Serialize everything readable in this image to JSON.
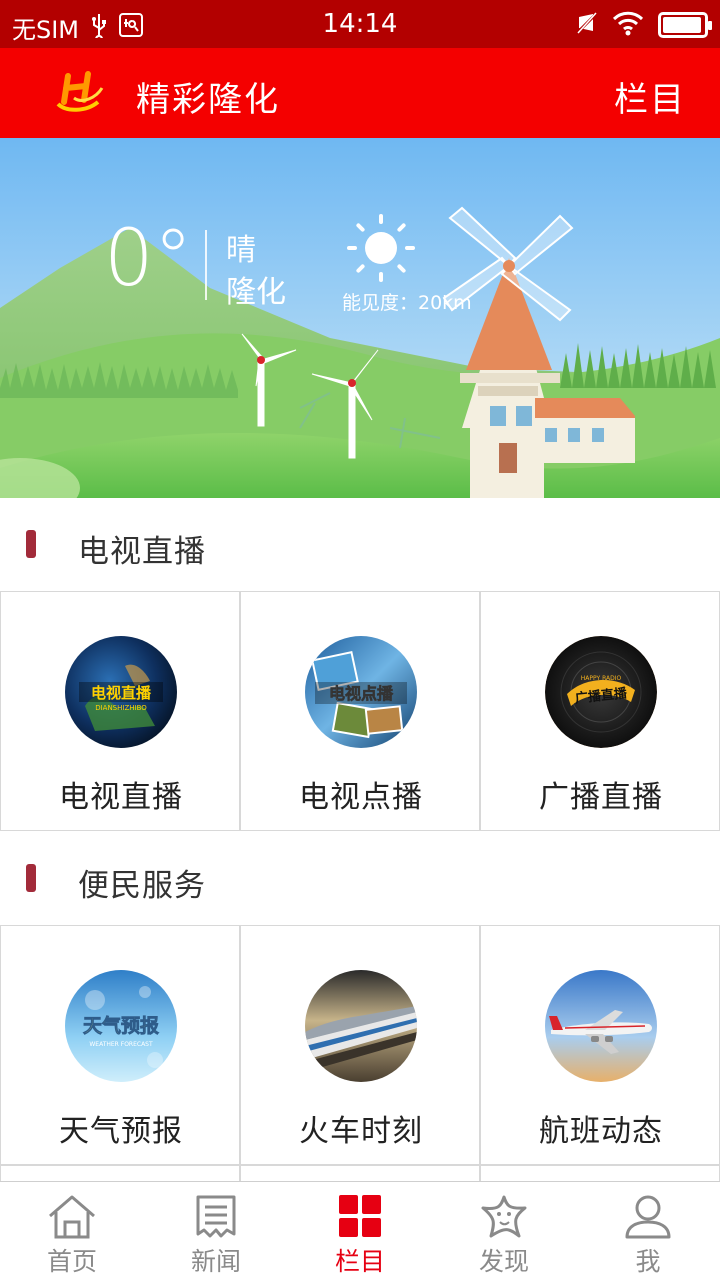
{
  "status_bar": {
    "carrier": "无SIM",
    "time": "14:14",
    "battery_level": 0.95
  },
  "header": {
    "title": "精彩隆化",
    "right_label": "栏目"
  },
  "weather": {
    "temperature": "0°",
    "condition": "晴",
    "city": "隆化",
    "visibility": "能见度：20km"
  },
  "sections": [
    {
      "title": "电视直播",
      "items": [
        {
          "label": "电视直播",
          "icon_text": "电视直播",
          "icon_sub": "DIANSHIZHIBO",
          "icon": "earth-tv-icon"
        },
        {
          "label": "电视点播",
          "icon_text": "电视点播",
          "icon": "film-tv-icon"
        },
        {
          "label": "广播直播",
          "icon_text": "广播直播",
          "icon_sub": "HAPPY RADIO",
          "icon": "radio-disc-icon"
        }
      ]
    },
    {
      "title": "便民服务",
      "items": [
        {
          "label": "天气预报",
          "icon_text": "天气预报",
          "icon_sub": "WEATHER FORECAST",
          "icon": "weather-icon"
        },
        {
          "label": "火车时刻",
          "icon": "train-icon"
        },
        {
          "label": "航班动态",
          "icon": "airplane-icon"
        }
      ]
    }
  ],
  "bottom_nav": [
    {
      "label": "首页",
      "icon": "home-icon",
      "active": false
    },
    {
      "label": "新闻",
      "icon": "news-icon",
      "active": false
    },
    {
      "label": "栏目",
      "icon": "grid-icon",
      "active": true
    },
    {
      "label": "发现",
      "icon": "starfish-icon",
      "active": false
    },
    {
      "label": "我",
      "icon": "person-icon",
      "active": false
    }
  ],
  "colors": {
    "status_bar": "#b30000",
    "header": "#f40000",
    "accent": "#e60012",
    "section_marker": "#a22b3a"
  }
}
